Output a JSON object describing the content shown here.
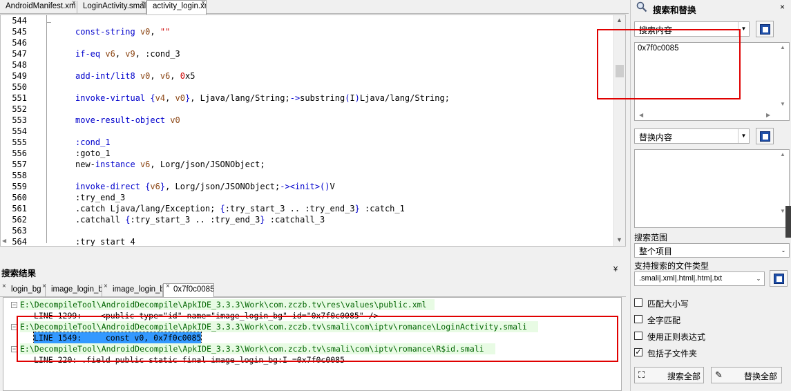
{
  "file_tabs": [
    {
      "label": "AndroidManifest.xm",
      "active": false
    },
    {
      "label": "LoginActivity.smali",
      "active": false
    },
    {
      "label": "activity_login.xm",
      "active": true
    }
  ],
  "editor": {
    "lines": [
      {
        "num": "544",
        "html": ""
      },
      {
        "num": "545",
        "html": "<span class=\"kw\">const-string</span> <span class=\"rg\">v0</span>, <span class=\"num\">\"\"</span>"
      },
      {
        "num": "546",
        "html": ""
      },
      {
        "num": "547",
        "html": "<span class=\"kw\">if-eq</span> <span class=\"rg\">v6</span>, <span class=\"rg\">v9</span>, :cond_3"
      },
      {
        "num": "548",
        "html": ""
      },
      {
        "num": "549",
        "html": "<span class=\"kw\">add-int/lit8</span> <span class=\"rg\">v0</span>, <span class=\"rg\">v6</span>, <span class=\"num\">0</span>x5"
      },
      {
        "num": "550",
        "html": ""
      },
      {
        "num": "551",
        "html": "<span class=\"kw\">invoke-virtual</span> <span class=\"kw\">{</span><span class=\"rg\">v4</span>, <span class=\"rg\">v0</span><span class=\"kw\">}</span>, Ljava/lang/String;<span class=\"kw\">-&gt;</span>substring<span class=\"kw\">(</span>I<span class=\"kw\">)</span>Ljava/lang/String;"
      },
      {
        "num": "552",
        "html": ""
      },
      {
        "num": "553",
        "html": "<span class=\"kw\">move-result-object</span> <span class=\"rg\">v0</span>"
      },
      {
        "num": "554",
        "html": ""
      },
      {
        "num": "555",
        "html": "<span class=\"cl\">:cond_1</span>"
      },
      {
        "num": "556",
        "html": ":goto_1"
      },
      {
        "num": "557",
        "html": "new-<span class=\"kw\">instance</span> <span class=\"rg\">v6</span>, Lorg/json/JSONObject;"
      },
      {
        "num": "558",
        "html": ""
      },
      {
        "num": "559",
        "html": "<span class=\"kw\">invoke-direct</span> <span class=\"kw\">{</span><span class=\"rg\">v6</span><span class=\"kw\">}</span>, Lorg/json/JSONObject;<span class=\"kw\">-&gt;&lt;init&gt;()</span>V"
      },
      {
        "num": "560",
        "html": ":try_end_3"
      },
      {
        "num": "561",
        "html": ".catch Ljava/lang/Exception; <span class=\"kw\">{</span>:try_start_3 .. :try_end_3<span class=\"kw\">}</span> :catch_1"
      },
      {
        "num": "562",
        "html": ".catchall <span class=\"kw\">{</span>:try_start_3 .. :try_end_3<span class=\"kw\">}</span> :catchall_3"
      },
      {
        "num": "563",
        "html": ""
      },
      {
        "num": "564",
        "html": ":try_start_4"
      }
    ]
  },
  "results": {
    "title": "搜索结果",
    "collapse_glyph": "¥",
    "tabs": [
      {
        "label": "login_bg",
        "active": false
      },
      {
        "label": "image_login_bg",
        "active": false
      },
      {
        "label": "image_login_bg",
        "active": false
      },
      {
        "label": "0x7f0c0085",
        "active": true
      }
    ],
    "items": [
      {
        "type": "file",
        "text": "E:\\DecompileTool\\AndroidDecompile\\ApkIDE_3.3.3\\Work\\com.zczb.tv\\res\\values\\public.xml"
      },
      {
        "type": "hit",
        "text": "LINE 1299:    <public type=\"id\" name=\"image_login_bg\" id=\"0x7f0c0085\" />"
      },
      {
        "type": "file",
        "text": "E:\\DecompileTool\\AndroidDecompile\\ApkIDE_3.3.3\\Work\\com.zczb.tv\\smali\\com\\iptv\\romance\\LoginActivity.smali"
      },
      {
        "type": "hit",
        "text": "LINE 1549:     const v0, 0x7f0c0085",
        "highlight": true
      },
      {
        "type": "file",
        "text": "E:\\DecompileTool\\AndroidDecompile\\ApkIDE_3.3.3\\Work\\com.zczb.tv\\smali\\com\\iptv\\romance\\R$id.smali"
      },
      {
        "type": "hit",
        "text": "LINE 220: .field public static final image_login_bg:I =0x7f0c0085"
      }
    ]
  },
  "search_panel": {
    "title": "搜索和替换",
    "close_glyph": "×",
    "search_combo": "搜索内容",
    "search_text": "0x7f0c0085",
    "replace_combo": "替换内容",
    "replace_text": "",
    "scope_label": "搜索范围",
    "scope_value": "整个项目",
    "filetypes_label": "支持搜索的文件类型",
    "filetypes_value": ".smali|.xml|.html|.htm|.txt",
    "options": [
      {
        "label": "匹配大小写",
        "checked": false
      },
      {
        "label": "全字匹配",
        "checked": false
      },
      {
        "label": "使用正则表达式",
        "checked": false
      },
      {
        "label": "包括子文件夹",
        "checked": true
      }
    ],
    "search_all_label": "搜索全部",
    "replace_all_label": "替换全部"
  },
  "colors": {
    "highlight": "#3399ff",
    "annotation_red": "#e00000",
    "file_line_bg": "#e8fbe4",
    "file_line_text": "#006400"
  }
}
